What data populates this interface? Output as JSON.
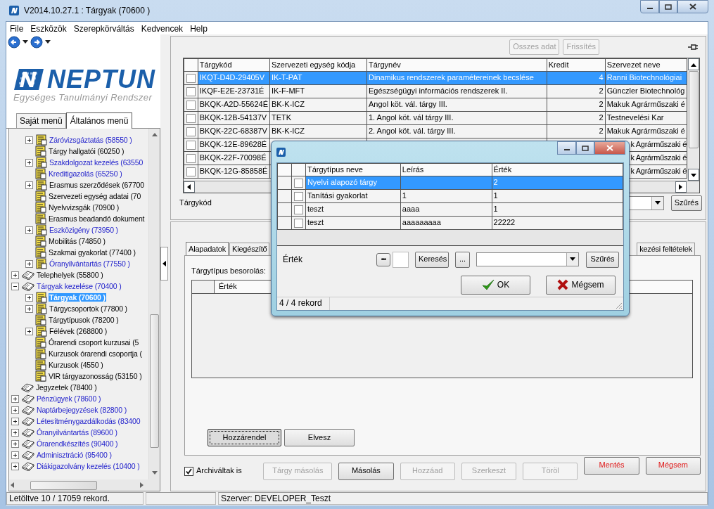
{
  "window": {
    "title": "V2014.10.27.1 : Tárgyak (70600 )"
  },
  "menu": [
    "File",
    "Eszközök",
    "Szerepkörváltás",
    "Kedvencek",
    "Help"
  ],
  "logo": {
    "wordmark": "NEPTUN",
    "tagline": "Egységes Tanulmányi Rendszer"
  },
  "sidebar_tabs": [
    {
      "label": "Saját menü",
      "selected": false
    },
    {
      "label": "Általános menü",
      "selected": true
    }
  ],
  "tree": [
    {
      "children": [
        {
          "label": "Záróvizsgáztatás (58550 )",
          "link": true,
          "expanded": false,
          "selected": false
        },
        {
          "label": "Tárgy hallgatói (60250 )",
          "link": false,
          "selected": false
        },
        {
          "label": "Szakdolgozat kezelés (63550",
          "link": true,
          "expanded": false,
          "selected": false
        },
        {
          "label": "Kreditigazolás (65250 )",
          "link": true,
          "selected": false
        },
        {
          "label": "Erasmus szerződések (67700",
          "link": false,
          "expanded": false,
          "selected": false
        },
        {
          "label": "Szervezeti egység adatai (70",
          "link": false,
          "selected": false
        },
        {
          "label": "Nyelvvizsgák (70900 )",
          "link": false,
          "selected": false
        },
        {
          "label": "Erasmus beadandó dokument",
          "link": false,
          "selected": false
        },
        {
          "label": "Eszközigény (73950 )",
          "link": true,
          "expanded": false,
          "selected": false
        },
        {
          "label": "Mobilitás (74850 )",
          "link": false,
          "selected": false
        },
        {
          "label": "Szakmai gyakorlat (77400 )",
          "link": false,
          "selected": false
        },
        {
          "label": "Óranyilvántartás (77550 )",
          "link": true,
          "expanded": false,
          "selected": false
        }
      ]
    },
    {
      "label": "Telephelyek (55800 )",
      "link": false,
      "expanded": false,
      "selected": false
    },
    {
      "label": "Tárgyak kezelése (70400 )",
      "link": true,
      "expanded": true,
      "selected": false,
      "children": [
        {
          "label": "Tárgyak (70600 )",
          "link": true,
          "expanded": false,
          "selected": true
        },
        {
          "label": "Tárgycsoportok (77800 )",
          "link": false,
          "expanded": false,
          "selected": false
        },
        {
          "label": "Tárgytípusok (78200 )",
          "link": false,
          "selected": false
        },
        {
          "label": "Félévek (268800 )",
          "link": false,
          "expanded": false,
          "selected": false
        },
        {
          "label": "Órarendi csoport kurzusai (5",
          "link": false,
          "selected": false
        },
        {
          "label": "Kurzusok órarendi csoportja (",
          "link": false,
          "selected": false
        },
        {
          "label": "Kurzusok (4550 )",
          "link": false,
          "selected": false
        },
        {
          "label": "VIR tárgyazonosság (53150 )",
          "link": false,
          "selected": false
        }
      ]
    },
    {
      "label": "Jegyzetek (78400 )",
      "link": false,
      "selected": false
    },
    {
      "label": "Pénzügyek (78600 )",
      "link": true,
      "expanded": false,
      "selected": false
    },
    {
      "label": "Naptárbejegyzések (82800 )",
      "link": true,
      "expanded": false,
      "selected": false
    },
    {
      "label": "Létesítménygazdálkodás (83400",
      "link": true,
      "expanded": false,
      "selected": false
    },
    {
      "label": "Óranyilvántartás (89600 )",
      "link": true,
      "expanded": false,
      "selected": false
    },
    {
      "label": "Órarendkészítés (90400 )",
      "link": true,
      "expanded": false,
      "selected": false
    },
    {
      "label": "Adminisztráció (95400 )",
      "link": true,
      "expanded": false,
      "selected": false
    },
    {
      "label": "Diákigazolvány kezelés (10400 )",
      "link": true,
      "expanded": false,
      "selected": false
    }
  ],
  "toolbar": [
    {
      "label": "Összes adat",
      "disabled": true
    },
    {
      "label": "Frissítés",
      "disabled": true
    }
  ],
  "grid": {
    "columns": [
      "Tárgykód",
      "Szervezeti egység kódja",
      "Tárgynév",
      "Kredit",
      "Szervezet neve"
    ],
    "rows": [
      {
        "checked": false,
        "selected": true,
        "cells": [
          "IKQT-D4D-29405V",
          "IK-T-PAT",
          "Dinamikus rendszerek paramétereinek becslése",
          "4",
          "Ranni Biotechnológiai"
        ]
      },
      {
        "checked": false,
        "selected": false,
        "cells": [
          "IKQF-E2E-23731É",
          "IK-F-MFT",
          "Egészségügyi információs rendszerek II.",
          "2",
          "Günczler Biotechnológ"
        ]
      },
      {
        "checked": false,
        "selected": false,
        "cells": [
          "BKQK-A2D-55624É",
          "BK-K-ICZ",
          "Angol köt. vál. tárgy III.",
          "2",
          "Makuk Agrárműszaki é"
        ]
      },
      {
        "checked": false,
        "selected": false,
        "cells": [
          "BKQK-12B-54137V",
          "TETK",
          "1. Angol köt. vál tárgy III.",
          "2",
          "Testnevelési Kar"
        ]
      },
      {
        "checked": false,
        "selected": false,
        "cells": [
          "BKQK-22C-68387V",
          "BK-K-ICZ",
          "2. Angol köt. vál. tárgy III.",
          "2",
          "Makuk Agrárműszaki é"
        ]
      },
      {
        "checked": false,
        "selected": false,
        "cells": [
          "BKQK-12E-89628É",
          null,
          null,
          null,
          "k Agrárműszaki é"
        ]
      },
      {
        "checked": false,
        "selected": false,
        "cells": [
          "BKQK-22F-70098É",
          null,
          null,
          null,
          "k Agrárműszaki é"
        ]
      },
      {
        "checked": false,
        "selected": false,
        "cells": [
          "BKQK-12G-85858É",
          null,
          null,
          null,
          "k Agrárműszaki é"
        ]
      }
    ]
  },
  "filter": {
    "label": "Tárgykód",
    "button": "Szűrés"
  },
  "detail_tabs": [
    {
      "label": "Alapadatok",
      "selected": true
    },
    {
      "label": "Kiegészítő",
      "selected": false
    },
    {
      "label": "kezési feltételek",
      "selected": false
    }
  ],
  "detail": {
    "label": "Tárgytípus besorolás:",
    "columns": [
      "Érték"
    ],
    "buttons": [
      {
        "label": "Hozzárendel",
        "focused": true
      },
      {
        "label": "Elvesz",
        "focused": false
      }
    ]
  },
  "archived": {
    "label": "Archiváltak is",
    "checked": true
  },
  "actions": [
    {
      "label": "Tárgy másolás",
      "disabled": true,
      "kind": "plain"
    },
    {
      "label": "Másolás",
      "disabled": false,
      "kind": "plain"
    },
    {
      "label": "Hozzáad",
      "disabled": true,
      "kind": "plain"
    },
    {
      "label": "Szerkeszt",
      "disabled": true,
      "kind": "plain"
    },
    {
      "label": "Töröl",
      "disabled": true,
      "kind": "plain"
    },
    {
      "label": "Mentés",
      "disabled": false,
      "kind": "alert"
    },
    {
      "label": "Mégsem",
      "disabled": false,
      "kind": "alert"
    }
  ],
  "status_bar": {
    "records": "Letöltve 10 / 17059 rekord.",
    "server": "Szerver: DEVELOPER_Teszt"
  },
  "dialog": {
    "columns": [
      "Tárgytípus neve",
      "Leírás",
      "Érték"
    ],
    "rows": [
      {
        "checked": false,
        "selected": true,
        "cells": [
          "Nyelvi alapozó tárgy",
          null,
          "2"
        ]
      },
      {
        "checked": false,
        "selected": false,
        "cells": [
          "Tanítási gyakorlat",
          "1",
          "1"
        ]
      },
      {
        "checked": false,
        "selected": false,
        "cells": [
          "teszt",
          "aaaa",
          "1"
        ]
      },
      {
        "checked": false,
        "selected": false,
        "cells": [
          "teszt",
          "aaaaaaaaa",
          "22222"
        ]
      }
    ],
    "search": {
      "label": "Érték",
      "more": "•••",
      "search_button": "Keresés",
      "ellipsis": "...",
      "filter_button": "Szűrés"
    },
    "ok": "OK",
    "cancel": "Mégsem",
    "status": "4 / 4 rekord"
  }
}
